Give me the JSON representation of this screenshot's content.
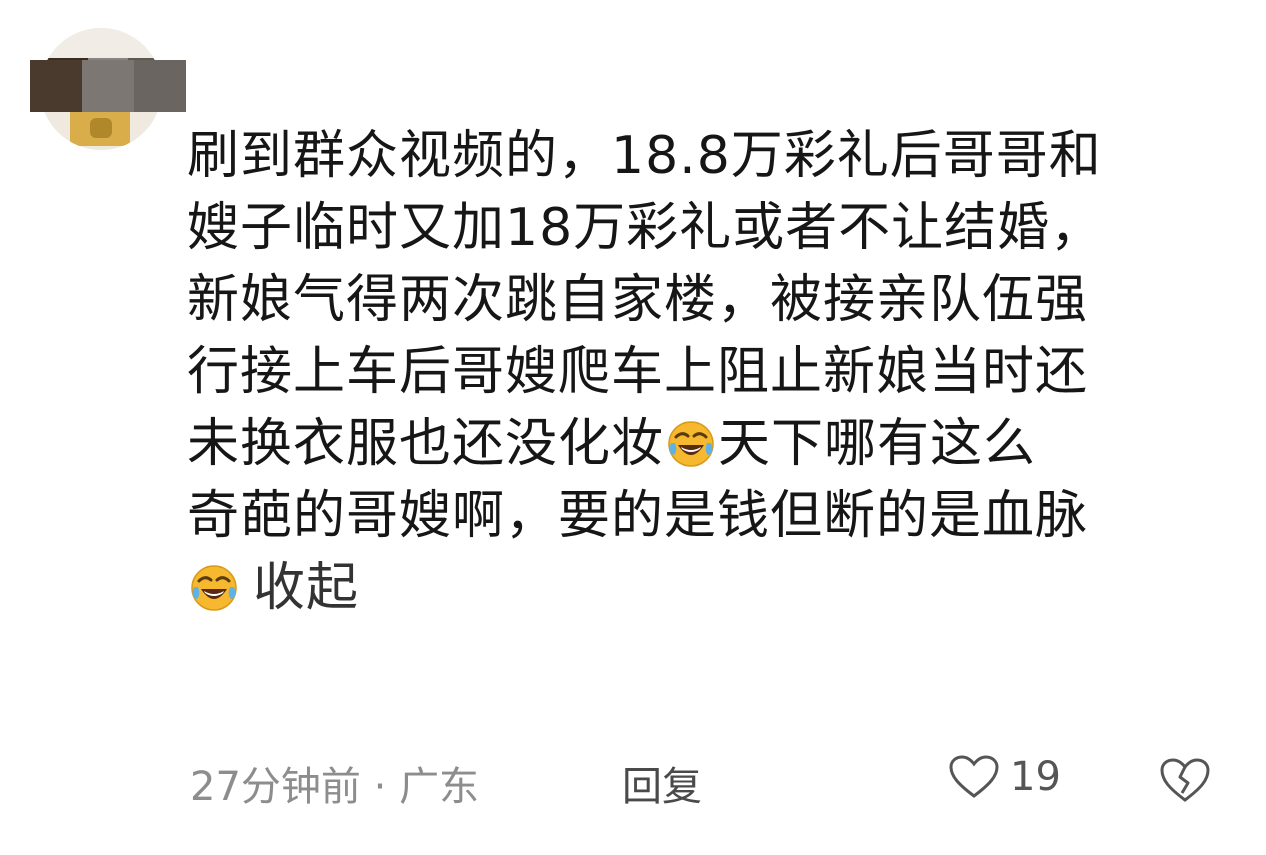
{
  "comment": {
    "lines": [
      "刷到群众视频的，18.8万彩礼后哥哥和",
      "嫂子临时又加18万彩礼或者不让结婚，",
      "新娘气得两次跳自家楼，被接亲队伍强",
      "行接上车后哥嫂爬车上阻止新娘当时还",
      "未换衣服也还没化妆",
      "天下哪有这么",
      "奇葩的哥嫂啊，要的是钱但断的是血脉"
    ],
    "collapse_label": "收起",
    "emoji_name": "laughing-crying-emoji"
  },
  "footer": {
    "time": "27分钟前",
    "separator": "·",
    "location": "广东",
    "reply_label": "回复",
    "like_count": "19"
  },
  "icons": {
    "like": "heart-outline-icon",
    "dislike": "broken-heart-outline-icon"
  },
  "colors": {
    "text": "#161616",
    "meta": "#8d8d8d",
    "emoji": "#f5b82e"
  }
}
